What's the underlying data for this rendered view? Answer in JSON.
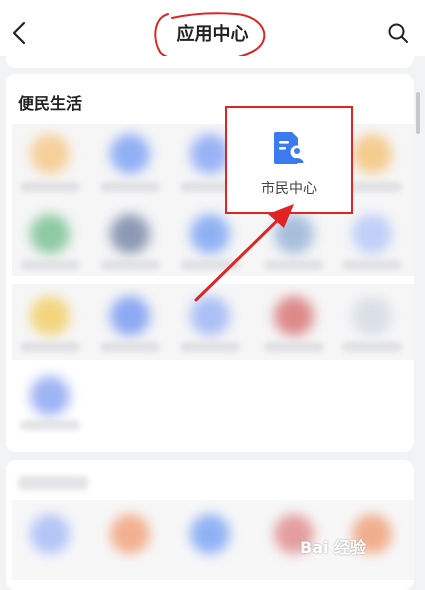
{
  "header": {
    "title": "应用中心",
    "back_icon": "back-arrow-icon",
    "search_icon": "search-icon"
  },
  "section": {
    "title": "便民生活",
    "highlighted_item": {
      "label": "市民中心",
      "icon": "citizen-center-icon",
      "icon_color": "#3b7bf0"
    }
  },
  "annotation": {
    "color": "#e02424"
  },
  "watermark": {
    "text": "Bai 经验"
  }
}
